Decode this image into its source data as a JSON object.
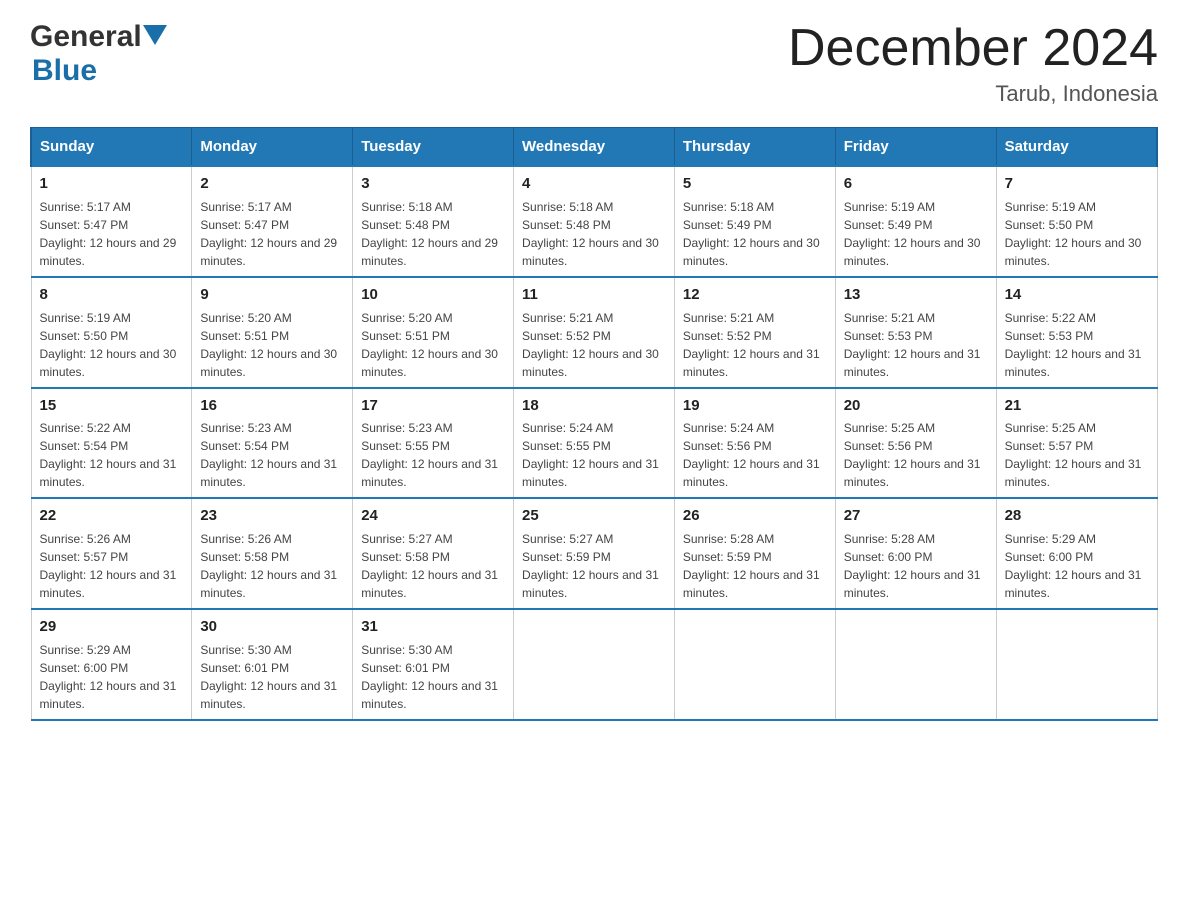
{
  "header": {
    "logo_general": "General",
    "logo_blue": "Blue",
    "main_title": "December 2024",
    "subtitle": "Tarub, Indonesia"
  },
  "calendar": {
    "days_of_week": [
      "Sunday",
      "Monday",
      "Tuesday",
      "Wednesday",
      "Thursday",
      "Friday",
      "Saturday"
    ],
    "weeks": [
      [
        {
          "day": "1",
          "sunrise": "5:17 AM",
          "sunset": "5:47 PM",
          "daylight": "12 hours and 29 minutes."
        },
        {
          "day": "2",
          "sunrise": "5:17 AM",
          "sunset": "5:47 PM",
          "daylight": "12 hours and 29 minutes."
        },
        {
          "day": "3",
          "sunrise": "5:18 AM",
          "sunset": "5:48 PM",
          "daylight": "12 hours and 29 minutes."
        },
        {
          "day": "4",
          "sunrise": "5:18 AM",
          "sunset": "5:48 PM",
          "daylight": "12 hours and 30 minutes."
        },
        {
          "day": "5",
          "sunrise": "5:18 AM",
          "sunset": "5:49 PM",
          "daylight": "12 hours and 30 minutes."
        },
        {
          "day": "6",
          "sunrise": "5:19 AM",
          "sunset": "5:49 PM",
          "daylight": "12 hours and 30 minutes."
        },
        {
          "day": "7",
          "sunrise": "5:19 AM",
          "sunset": "5:50 PM",
          "daylight": "12 hours and 30 minutes."
        }
      ],
      [
        {
          "day": "8",
          "sunrise": "5:19 AM",
          "sunset": "5:50 PM",
          "daylight": "12 hours and 30 minutes."
        },
        {
          "day": "9",
          "sunrise": "5:20 AM",
          "sunset": "5:51 PM",
          "daylight": "12 hours and 30 minutes."
        },
        {
          "day": "10",
          "sunrise": "5:20 AM",
          "sunset": "5:51 PM",
          "daylight": "12 hours and 30 minutes."
        },
        {
          "day": "11",
          "sunrise": "5:21 AM",
          "sunset": "5:52 PM",
          "daylight": "12 hours and 30 minutes."
        },
        {
          "day": "12",
          "sunrise": "5:21 AM",
          "sunset": "5:52 PM",
          "daylight": "12 hours and 31 minutes."
        },
        {
          "day": "13",
          "sunrise": "5:21 AM",
          "sunset": "5:53 PM",
          "daylight": "12 hours and 31 minutes."
        },
        {
          "day": "14",
          "sunrise": "5:22 AM",
          "sunset": "5:53 PM",
          "daylight": "12 hours and 31 minutes."
        }
      ],
      [
        {
          "day": "15",
          "sunrise": "5:22 AM",
          "sunset": "5:54 PM",
          "daylight": "12 hours and 31 minutes."
        },
        {
          "day": "16",
          "sunrise": "5:23 AM",
          "sunset": "5:54 PM",
          "daylight": "12 hours and 31 minutes."
        },
        {
          "day": "17",
          "sunrise": "5:23 AM",
          "sunset": "5:55 PM",
          "daylight": "12 hours and 31 minutes."
        },
        {
          "day": "18",
          "sunrise": "5:24 AM",
          "sunset": "5:55 PM",
          "daylight": "12 hours and 31 minutes."
        },
        {
          "day": "19",
          "sunrise": "5:24 AM",
          "sunset": "5:56 PM",
          "daylight": "12 hours and 31 minutes."
        },
        {
          "day": "20",
          "sunrise": "5:25 AM",
          "sunset": "5:56 PM",
          "daylight": "12 hours and 31 minutes."
        },
        {
          "day": "21",
          "sunrise": "5:25 AM",
          "sunset": "5:57 PM",
          "daylight": "12 hours and 31 minutes."
        }
      ],
      [
        {
          "day": "22",
          "sunrise": "5:26 AM",
          "sunset": "5:57 PM",
          "daylight": "12 hours and 31 minutes."
        },
        {
          "day": "23",
          "sunrise": "5:26 AM",
          "sunset": "5:58 PM",
          "daylight": "12 hours and 31 minutes."
        },
        {
          "day": "24",
          "sunrise": "5:27 AM",
          "sunset": "5:58 PM",
          "daylight": "12 hours and 31 minutes."
        },
        {
          "day": "25",
          "sunrise": "5:27 AM",
          "sunset": "5:59 PM",
          "daylight": "12 hours and 31 minutes."
        },
        {
          "day": "26",
          "sunrise": "5:28 AM",
          "sunset": "5:59 PM",
          "daylight": "12 hours and 31 minutes."
        },
        {
          "day": "27",
          "sunrise": "5:28 AM",
          "sunset": "6:00 PM",
          "daylight": "12 hours and 31 minutes."
        },
        {
          "day": "28",
          "sunrise": "5:29 AM",
          "sunset": "6:00 PM",
          "daylight": "12 hours and 31 minutes."
        }
      ],
      [
        {
          "day": "29",
          "sunrise": "5:29 AM",
          "sunset": "6:00 PM",
          "daylight": "12 hours and 31 minutes."
        },
        {
          "day": "30",
          "sunrise": "5:30 AM",
          "sunset": "6:01 PM",
          "daylight": "12 hours and 31 minutes."
        },
        {
          "day": "31",
          "sunrise": "5:30 AM",
          "sunset": "6:01 PM",
          "daylight": "12 hours and 31 minutes."
        },
        {
          "day": "",
          "sunrise": "",
          "sunset": "",
          "daylight": ""
        },
        {
          "day": "",
          "sunrise": "",
          "sunset": "",
          "daylight": ""
        },
        {
          "day": "",
          "sunrise": "",
          "sunset": "",
          "daylight": ""
        },
        {
          "day": "",
          "sunrise": "",
          "sunset": "",
          "daylight": ""
        }
      ]
    ]
  }
}
